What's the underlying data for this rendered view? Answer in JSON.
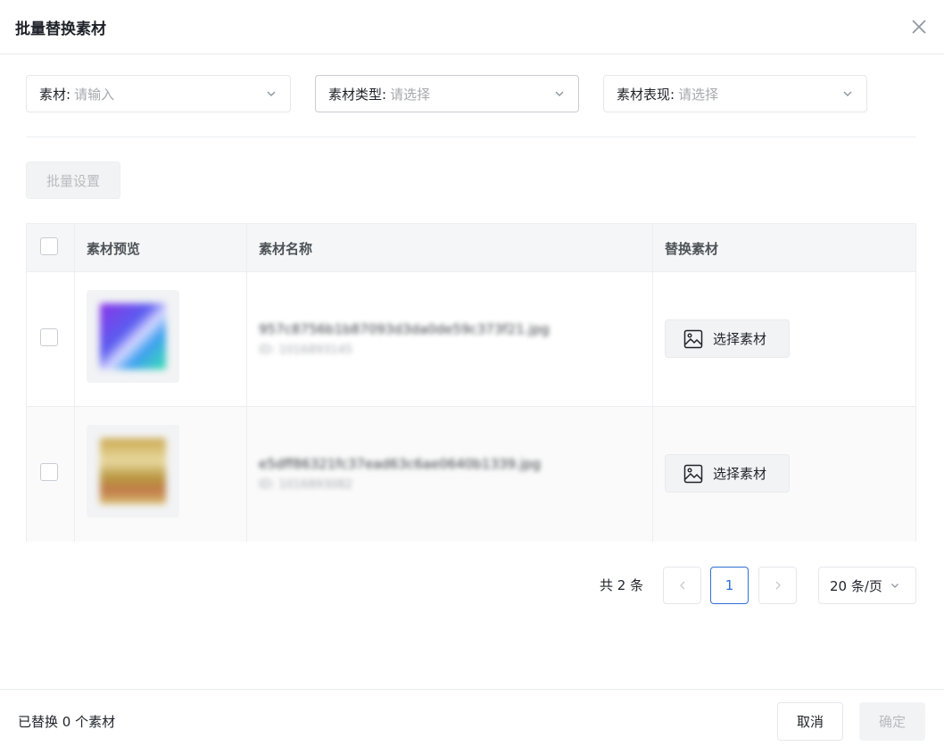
{
  "dialog": {
    "title": "批量替换素材"
  },
  "filters": [
    {
      "label": "素材:",
      "placeholder": "请输入"
    },
    {
      "label": "素材类型:",
      "placeholder": "请选择"
    },
    {
      "label": "素材表现:",
      "placeholder": "请选择"
    }
  ],
  "toolbar": {
    "batch_label": "批量设置"
  },
  "table": {
    "columns": [
      "素材预览",
      "素材名称",
      "替换素材"
    ],
    "rows": [
      {
        "name": "957c8756b1b87093d3da0de59c373f21.jpg",
        "id": "ID: 1016893145",
        "action": "选择素材"
      },
      {
        "name": "e5dff86321fc37ead63c6ae0640b1339.jpg",
        "id": "ID: 1016893082",
        "action": "选择素材"
      }
    ]
  },
  "pagination": {
    "total_text": "共 2 条",
    "current_page": "1",
    "page_size": "20 条/页"
  },
  "footer": {
    "status_text": "已替换 0 个素材",
    "cancel_label": "取消",
    "confirm_label": "确定"
  },
  "colors": {
    "accent": "#2e6fd6",
    "border": "#e5e7eb",
    "header_bg": "#f5f6f7"
  }
}
